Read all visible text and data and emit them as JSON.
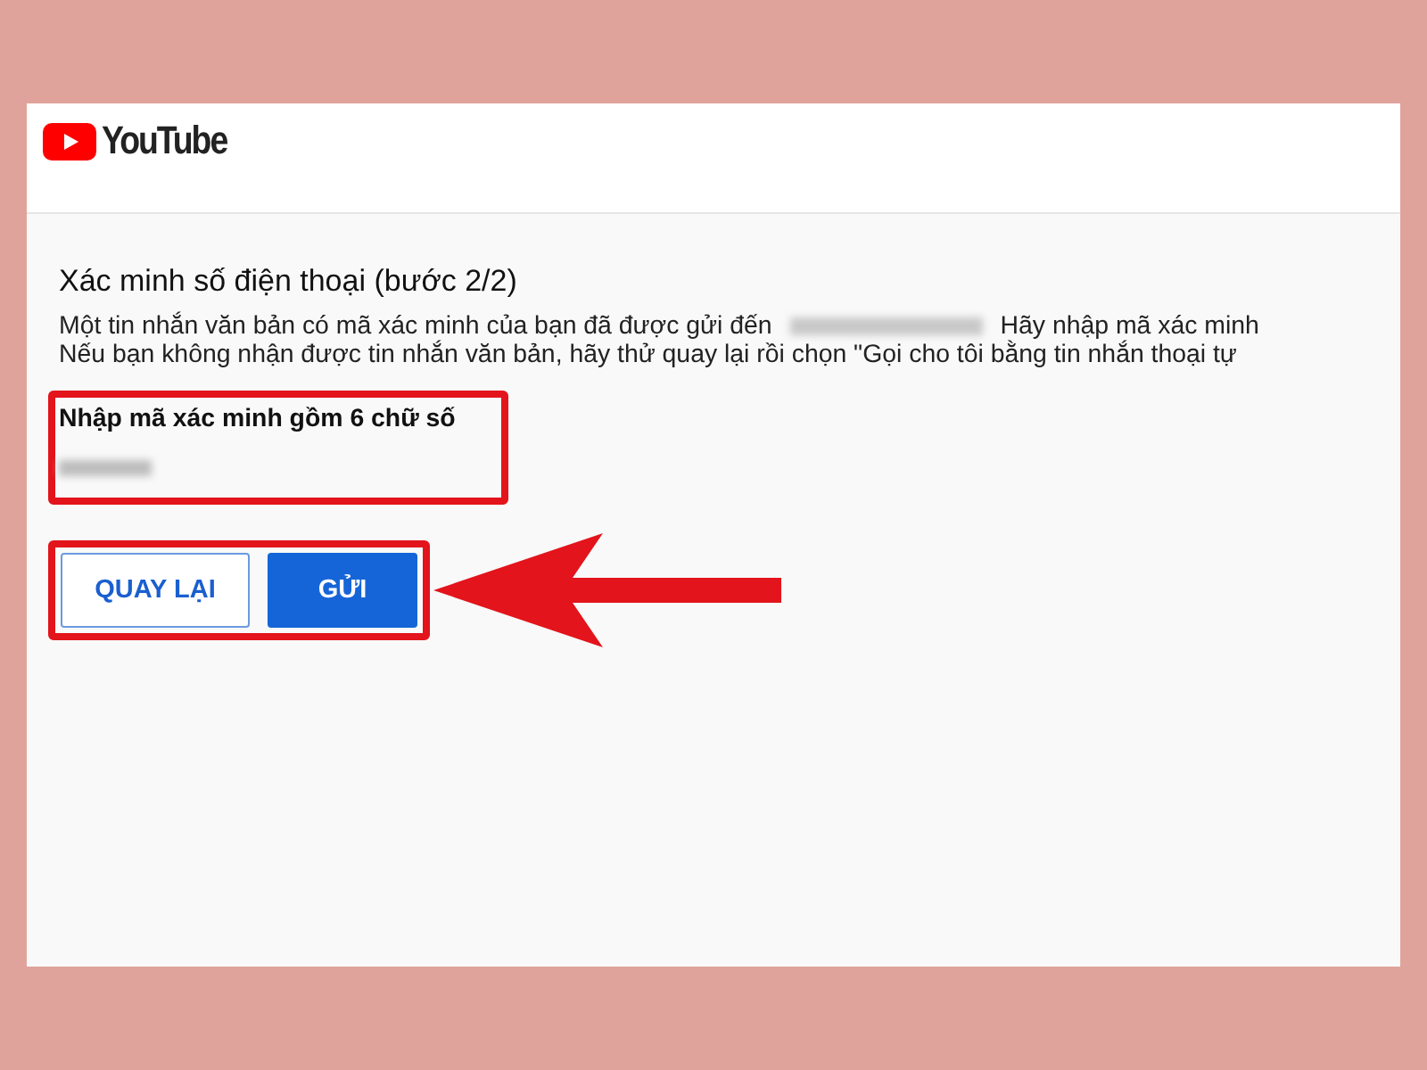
{
  "header": {
    "logo_text": "YouTube"
  },
  "title": "Xác minh số điện thoại (bước 2/2)",
  "message": {
    "before": "Một tin nhắn văn bản có mã xác minh của bạn đã được gửi đến",
    "after": "Hãy nhập mã xác minh"
  },
  "hint": "Nếu bạn không nhận được tin nhắn văn bản, hãy thử quay lại rồi chọn \"Gọi cho tôi bằng tin nhắn thoại tự",
  "code_field": {
    "label": "Nhập mã xác minh gồm 6 chữ số"
  },
  "buttons": [
    {
      "label": "QUAY LẠI",
      "kind": "outline"
    },
    {
      "label": "GỬI",
      "kind": "primary"
    }
  ]
}
